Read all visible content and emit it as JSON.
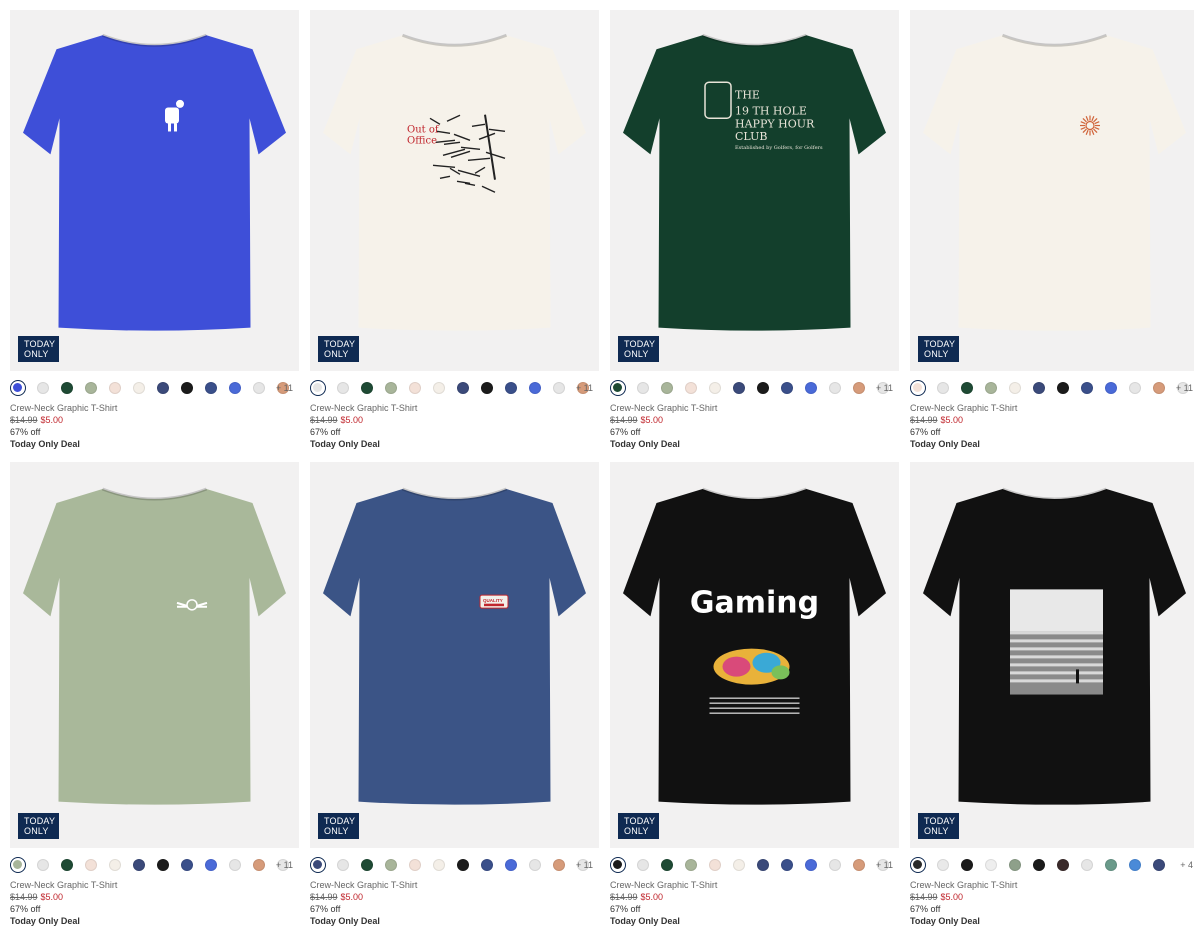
{
  "products": [
    {
      "name": "Crew-Neck Graphic T-Shirt",
      "was": "$14.99",
      "now": "$5.00",
      "off": "67% off",
      "deal": "Today Only Deal",
      "badge_line1": "TODAY",
      "badge_line2": "ONLY",
      "more": "+ 11",
      "shirt_color": "#3e4fd8",
      "graphic": "cup-mascot-graphic",
      "swatches": [
        "#3e4fd8",
        "#e6e6e6",
        "#1e4a34",
        "#a8b59a",
        "#f3e1d8",
        "#f4efe8",
        "#3b4a7a",
        "#1b1b1b",
        "#3a4f8a",
        "#4a6ad8",
        "#e6e6e6",
        "#d69b7a"
      ]
    },
    {
      "name": "Crew-Neck Graphic T-Shirt",
      "was": "$14.99",
      "now": "$5.00",
      "off": "67% off",
      "deal": "Today Only Deal",
      "badge_line1": "TODAY",
      "badge_line2": "ONLY",
      "more": "+ 11",
      "shirt_color": "#f6f2ea",
      "graphic": "out-of-office-graphic",
      "graphic_text": [
        "Out of",
        "Office"
      ],
      "swatches": [
        "#e6e6e6",
        "#e6e6e6",
        "#1e4a34",
        "#a8b59a",
        "#f3e1d8",
        "#f4efe8",
        "#3b4a7a",
        "#1b1b1b",
        "#3a4f8a",
        "#4a6ad8",
        "#e6e6e6",
        "#d69b7a"
      ]
    },
    {
      "name": "Crew-Neck Graphic T-Shirt",
      "was": "$14.99",
      "now": "$5.00",
      "off": "67% off",
      "deal": "Today Only Deal",
      "badge_line1": "TODAY",
      "badge_line2": "ONLY",
      "more": "+ 11",
      "shirt_color": "#133f2c",
      "graphic": "19th-hole-graphic",
      "graphic_text": [
        "THE",
        "19 TH HOLE",
        "HAPPY HOUR",
        "CLUB",
        "Established by Golfers, for Golfers"
      ],
      "swatches": [
        "#1e4a34",
        "#e6e6e6",
        "#a8b59a",
        "#f3e1d8",
        "#f4efe8",
        "#3b4a7a",
        "#1b1b1b",
        "#3a4f8a",
        "#4a6ad8",
        "#e6e6e6",
        "#d69b7a",
        "#e6e6e6"
      ]
    },
    {
      "name": "Crew-Neck Graphic T-Shirt",
      "was": "$14.99",
      "now": "$5.00",
      "off": "67% off",
      "deal": "Today Only Deal",
      "badge_line1": "TODAY",
      "badge_line2": "ONLY",
      "more": "+ 11",
      "shirt_color": "#f6f2ea",
      "graphic": "sun-graphic",
      "swatches": [
        "#f3e1d8",
        "#e6e6e6",
        "#1e4a34",
        "#a8b59a",
        "#f4efe8",
        "#3b4a7a",
        "#1b1b1b",
        "#3a4f8a",
        "#4a6ad8",
        "#e6e6e6",
        "#d69b7a",
        "#e6e6e6"
      ]
    },
    {
      "name": "Crew-Neck Graphic T-Shirt",
      "was": "$14.99",
      "now": "$5.00",
      "off": "67% off",
      "deal": "Today Only Deal",
      "badge_line1": "TODAY",
      "badge_line2": "ONLY",
      "more": "+ 11",
      "shirt_color": "#a9b89a",
      "graphic": "winged-emblem-graphic",
      "swatches": [
        "#a8b59a",
        "#e6e6e6",
        "#1e4a34",
        "#f3e1d8",
        "#f4efe8",
        "#3b4a7a",
        "#1b1b1b",
        "#3a4f8a",
        "#4a6ad8",
        "#e6e6e6",
        "#d69b7a",
        "#e6e6e6"
      ]
    },
    {
      "name": "Crew-Neck Graphic T-Shirt",
      "was": "$14.99",
      "now": "$5.00",
      "off": "67% off",
      "deal": "Today Only Deal",
      "badge_line1": "TODAY",
      "badge_line2": "ONLY",
      "more": "+ 11",
      "shirt_color": "#3b5486",
      "graphic": "quality-patch-graphic",
      "graphic_text": [
        "QUALITY"
      ],
      "swatches": [
        "#3b4a7a",
        "#e6e6e6",
        "#1e4a34",
        "#a8b59a",
        "#f3e1d8",
        "#f4efe8",
        "#1b1b1b",
        "#3a4f8a",
        "#4a6ad8",
        "#e6e6e6",
        "#d69b7a",
        "#e6e6e6"
      ]
    },
    {
      "name": "Crew-Neck Graphic T-Shirt",
      "was": "$14.99",
      "now": "$5.00",
      "off": "67% off",
      "deal": "Today Only Deal",
      "badge_line1": "TODAY",
      "badge_line2": "ONLY",
      "more": "+ 11",
      "shirt_color": "#111111",
      "graphic": "gaming-graphic",
      "graphic_text": [
        "Gaming"
      ],
      "swatches": [
        "#1b1b1b",
        "#e6e6e6",
        "#1e4a34",
        "#a8b59a",
        "#f3e1d8",
        "#f4efe8",
        "#3b4a7a",
        "#3a4f8a",
        "#4a6ad8",
        "#e6e6e6",
        "#d69b7a",
        "#e6e6e6"
      ]
    },
    {
      "name": "Crew-Neck Graphic T-Shirt",
      "was": "$14.99",
      "now": "$5.00",
      "off": "67% off",
      "deal": "Today Only Deal",
      "badge_line1": "TODAY",
      "badge_line2": "ONLY",
      "more": "+ 4",
      "shirt_color": "#111111",
      "graphic": "surf-photo-graphic",
      "swatches": [
        "#2a2a2a",
        "#e9e9e9",
        "#1b1b1b",
        "#eeeeee",
        "#8ea08a",
        "#1b1b1b",
        "#3a2a2a",
        "#e6e6e6",
        "#6a9a8a",
        "#4a8ad8",
        "#3b4a7a"
      ]
    }
  ]
}
